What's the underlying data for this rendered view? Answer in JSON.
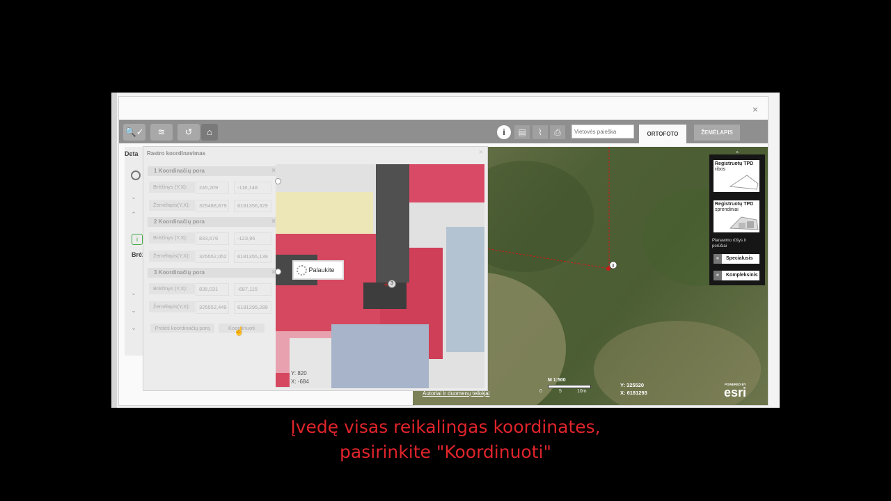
{
  "window": {
    "close_glyph": "×"
  },
  "toolbar": {
    "tools": [
      {
        "icon": "search-check-icon",
        "glyph": "🔍✓"
      },
      {
        "icon": "layers-icon",
        "glyph": "≋"
      },
      {
        "icon": "history-icon",
        "glyph": "↺"
      },
      {
        "icon": "home-icon",
        "glyph": "⌂"
      }
    ],
    "right_icons": [
      {
        "icon": "info-icon",
        "glyph": "i"
      },
      {
        "icon": "table-icon",
        "glyph": "▤"
      },
      {
        "icon": "chart-icon",
        "glyph": "⌇"
      },
      {
        "icon": "print-icon",
        "glyph": "⎙"
      }
    ],
    "search_placeholder": "Vietovės paieška",
    "tab_ortofoto": "ORTOFOTO",
    "tab_zemelapis": "ŽEMĖLAPIS"
  },
  "left_panel": {
    "label_top": "Deta",
    "label_mid": "Bréž"
  },
  "dialog": {
    "title": "Rastro koordinavimas",
    "close_glyph": "×",
    "pairs": [
      {
        "title": "1 Koordinačių pora",
        "brezinys_label": "Brėžinys (Y,X):",
        "brezinys_y": "245,209",
        "brezinys_x": "-116,148",
        "zemelapis_label": "Žemėlapis(Y,X):",
        "zemelapis_y": "325488,879",
        "zemelapis_x": "6181356,329"
      },
      {
        "title": "2 Koordinačių pora",
        "brezinys_label": "Brėžinys (Y,X):",
        "brezinys_y": "833,676",
        "brezinys_x": "-123,96",
        "zemelapis_label": "Žemėlapis(Y,X):",
        "zemelapis_y": "325552,052",
        "zemelapis_x": "6181355,139"
      },
      {
        "title": "3 Koordinačių pora",
        "brezinys_label": "Brėžinys (Y,X):",
        "brezinys_y": "835,031",
        "brezinys_x": "-687,115",
        "zemelapis_label": "Žemėlapis(Y,X):",
        "zemelapis_y": "325552,449",
        "zemelapis_x": "6181295,289"
      }
    ],
    "add_pair_button": "Pridėti koordinačių porą",
    "coordinate_button": "Koordinuoti",
    "wait_text": "Palaukite",
    "raster_y": "Y: 820",
    "raster_x": "X: -684",
    "marker_label": "3"
  },
  "map": {
    "marker_label": "3",
    "scale": "M 1:500",
    "scale_ticks": [
      "0",
      "5",
      "10m"
    ],
    "coord_y": "Y: 325520",
    "coord_x": "X: 6181293",
    "attribution": "Autoriai ir duomenų teikėjai",
    "esri_small": "POWERED BY",
    "esri_logo": "esri",
    "line_color": "#cc1a1a"
  },
  "legend": {
    "card1_title": "Registruotų TPD",
    "card1_sub": "ribos",
    "card2_title": "Registruotų TPD",
    "card2_sub": "sprendiniai",
    "planning_label": "Planavimo rūšys ir porūšiai",
    "btn_specialusis": "Specialusis",
    "btn_kompleksinis": "Kompleksinis",
    "chev": "«"
  },
  "caption": {
    "line1": "Įvedę visas reikalingas koordinates,",
    "line2": "pasirinkite \"Koordinuoti\""
  }
}
